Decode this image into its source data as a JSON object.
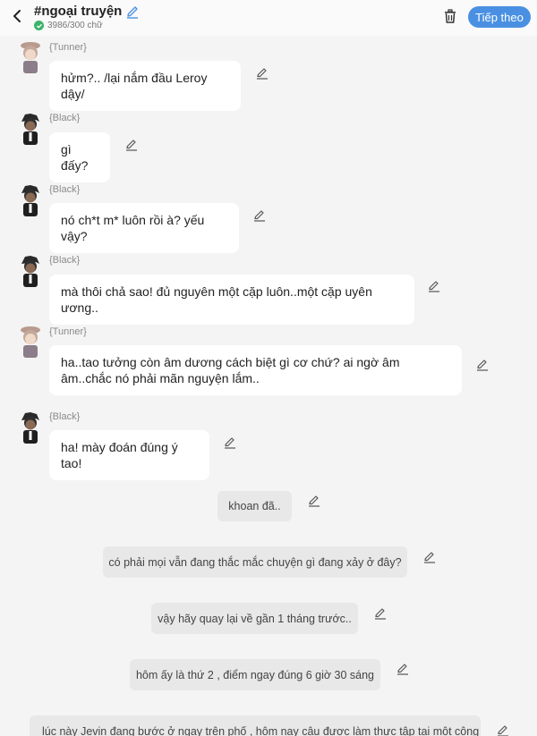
{
  "header": {
    "title": "#ngoại truyện",
    "word_count": "3986/300 chữ",
    "next_label": "Tiếp theo"
  },
  "messages": [
    {
      "speaker": "{Tunner}",
      "text": "hửm?.. /lại nắm đầu Leroy dậy/",
      "avatar": "tunner"
    },
    {
      "speaker": "{Black}",
      "text": "gì đấy?",
      "avatar": "black"
    },
    {
      "speaker": "{Black}",
      "text": "nó ch*t m* luôn rồi à? yếu vậy?",
      "avatar": "black"
    },
    {
      "speaker": "{Black}",
      "text": "mà thôi chả sao! đủ nguyên một cặp luôn..một cặp uyên ương..",
      "avatar": "black"
    },
    {
      "speaker": "{Tunner}",
      "text": "ha..tao tưởng còn âm dương cách biệt gì cơ chứ? ai ngờ âm âm..chắc nó phải mãn nguyện lắm..",
      "avatar": "tunner"
    },
    {
      "speaker": "{Black}",
      "text": "ha! mày đoán đúng ý tao!",
      "avatar": "black"
    }
  ],
  "narration": [
    "khoan đã..",
    "có phải mọi vẫn đang thắc mắc chuyện gì đang xảy ở đây?",
    "vậy hãy quay lại về gần 1 tháng trước..",
    "hôm ấy là thứ 2 , điểm ngay đúng 6 giờ 30 sáng",
    "lúc này Jevin đang bước ở ngay trên phố , hôm nay cậu được làm thực tập tại một công"
  ]
}
